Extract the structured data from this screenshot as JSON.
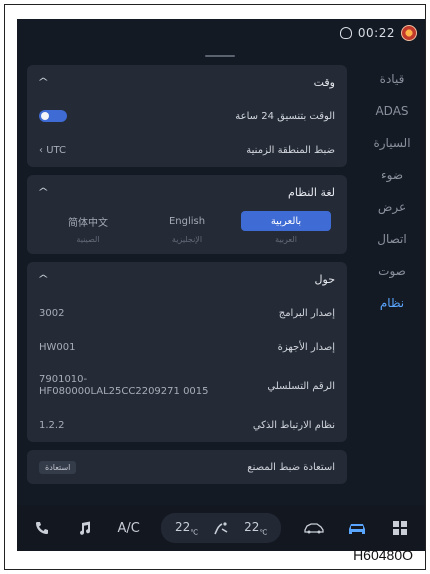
{
  "status": {
    "time": "00:22"
  },
  "nav": {
    "items": [
      {
        "label": "قيادة",
        "active": false
      },
      {
        "label": "ADAS",
        "active": false
      },
      {
        "label": "السيارة",
        "active": false
      },
      {
        "label": "ضوء",
        "active": false
      },
      {
        "label": "عرض",
        "active": false
      },
      {
        "label": "اتصال",
        "active": false
      },
      {
        "label": "صوت",
        "active": false
      },
      {
        "label": "نظام",
        "active": true
      }
    ]
  },
  "time_card": {
    "title": "وقت",
    "rows": [
      {
        "label": "الوقت بتنسيق 24 ساعة",
        "toggle_on": true
      },
      {
        "label": "ضبط المنطقة الزمنية",
        "value": "UTC"
      }
    ]
  },
  "language_card": {
    "title": "لغة النظام",
    "options": [
      {
        "label": "بالعربية",
        "sub": "العربية",
        "selected": true
      },
      {
        "label": "English",
        "sub": "الإنجليزية",
        "selected": false
      },
      {
        "label": "简体中文",
        "sub": "الصينية",
        "selected": false
      }
    ]
  },
  "about_card": {
    "title": "حول",
    "rows": [
      {
        "label": "إصدار البرامج",
        "value": "3002"
      },
      {
        "label": "إصدار الأجهزة",
        "value": "HW001"
      },
      {
        "label": "الرقم التسلسلي",
        "value": "7901010-HF080000LAL25CC2209271 0015"
      },
      {
        "label": "نظام الارتباط الذكي",
        "value": "1.2.2"
      }
    ]
  },
  "factory_card": {
    "label": "استعادة ضبط المصنع",
    "button": "استعادة"
  },
  "bottombar": {
    "ac_label": "A/C",
    "temp_left": "22",
    "temp_right": "22",
    "temp_unit": "℃"
  },
  "caption": "H60480O"
}
